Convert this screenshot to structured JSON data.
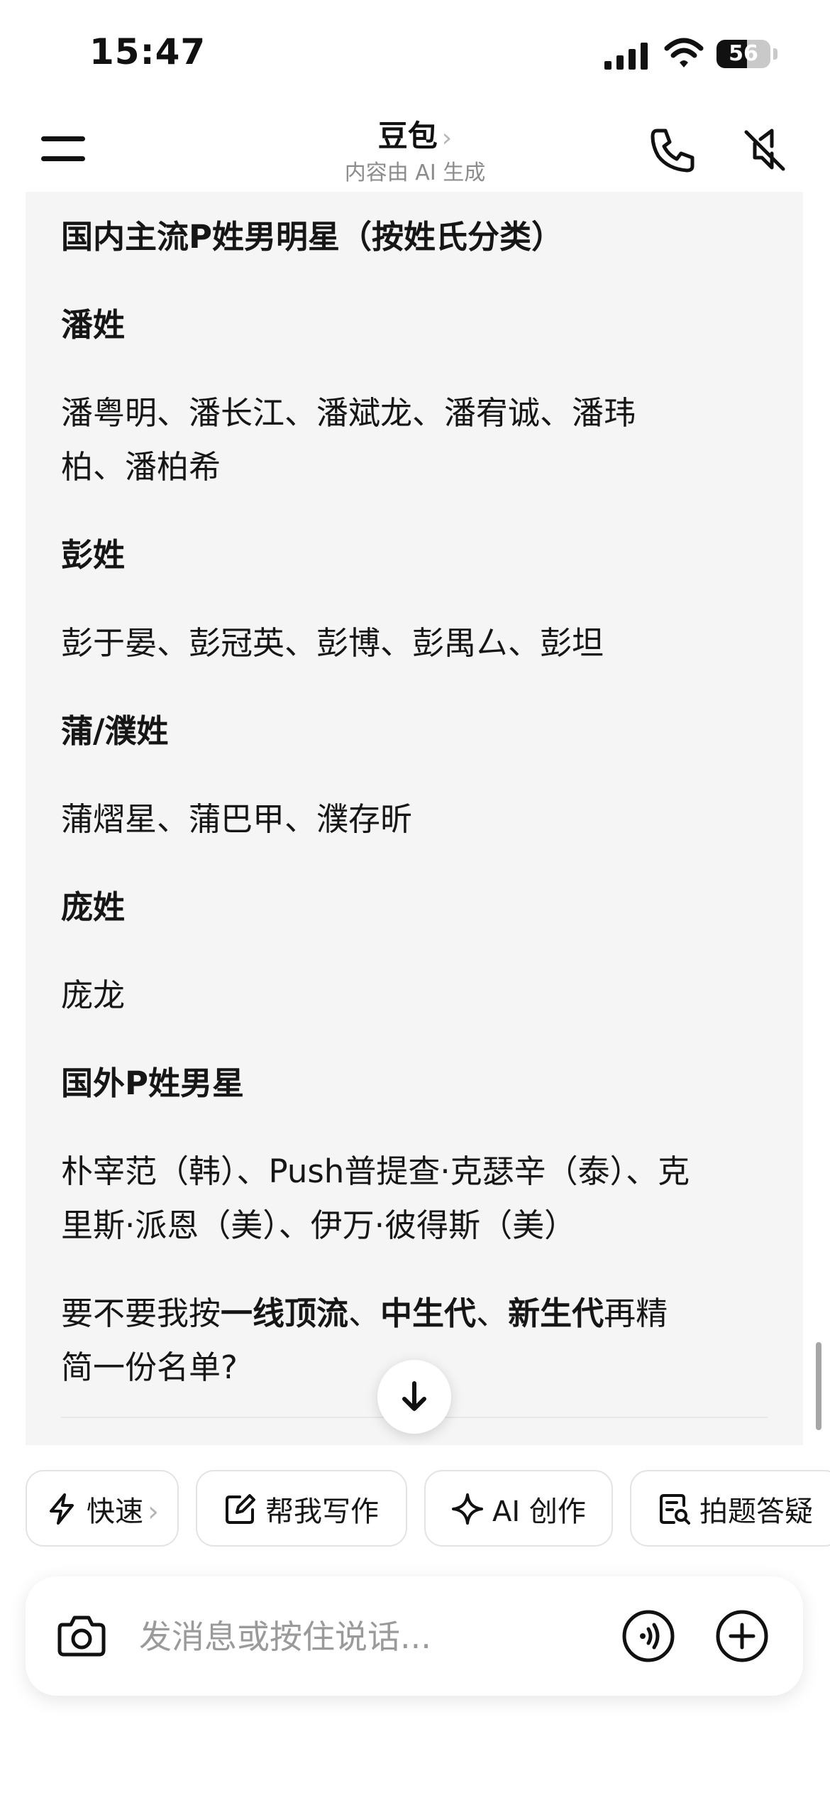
{
  "status_bar": {
    "time": "15:47",
    "battery": "56",
    "battery_level": 0.56
  },
  "header": {
    "title": "豆包",
    "title_chevron": "›",
    "subtitle": "内容由 AI 生成"
  },
  "message": {
    "heading": "国内主流P姓男明星（按姓氏分类）",
    "sections": [
      {
        "title": "潘姓",
        "line1": "潘粤明、潘长江、潘斌龙、潘宥诚、潘玮",
        "line2": "柏、潘柏希"
      },
      {
        "title": "彭姓",
        "line1": "彭于晏、彭冠英、彭博、彭禺厶、彭坦"
      },
      {
        "title": "蒲/濮姓",
        "line1": "蒲熠星、蒲巴甲、濮存昕"
      },
      {
        "title": "庞姓",
        "line1": "庞龙"
      },
      {
        "title": "国外P姓男星",
        "line1": "朴宰范（韩）、Push普提查·克瑟辛（泰）、克",
        "line2": "里斯·派恩（美）、伊万·彼得斯（美）"
      }
    ],
    "closing": {
      "part1": "要不要我按",
      "bold1": "一线顶流",
      "sep1": "、",
      "bold2": "中生代",
      "sep2": "、",
      "bold3": "新生代",
      "part2": "再精",
      "line2": "简一份名单?"
    }
  },
  "quick_actions": [
    {
      "label": "快速",
      "chevron": "›",
      "icon": "lightning-icon"
    },
    {
      "label": "帮我写作",
      "icon": "edit-icon"
    },
    {
      "label": "AI 创作",
      "icon": "sparkle-icon"
    },
    {
      "label": "拍题答疑",
      "icon": "scan-question-icon"
    }
  ],
  "input": {
    "placeholder": "发消息或按住说话..."
  },
  "colors": {
    "message_bg": "#f5f5f6",
    "text": "#161616",
    "muted": "#8c8c8c",
    "chip_border": "#e3e3e3"
  }
}
